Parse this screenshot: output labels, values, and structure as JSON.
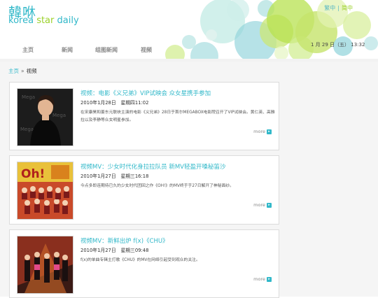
{
  "header": {
    "logo_cn": "韓咻",
    "logo_en_parts": [
      "korea ",
      "star",
      " daily"
    ],
    "lang": [
      "繁中",
      "|",
      "简中"
    ],
    "date": "1  月  29  日（五）  13:32"
  },
  "nav": [
    "主页",
    "新闻",
    "组图新闻",
    "视频"
  ],
  "breadcrumb": {
    "home": "主页",
    "sep": "»",
    "current": "视频"
  },
  "articles": [
    {
      "title": "视频：电影《义兄弟》VIP试映会 众女星携手参加",
      "date": "2010年1月28日　星期四11:02",
      "desc": "在宋康昊和姜东元联袂主演的电影《义兄弟》28日于首尔MEGABOX电影院召开了VIP试映会。黄仁英、高雅拉以及李静等众女明星参加。",
      "more": "more"
    },
    {
      "title": "视频MV：少女时代化身拉拉队员 新MV轻盈开嗓秘笛沙",
      "date": "2010年1月27日　星期三16:18",
      "desc": "今点多即连期待已久的少女时代团回之作《OH!》的MV终于于27日解开了神秘面纱。",
      "more": "more"
    },
    {
      "title": "视频MV：新鲜出炉 f(x)《CHU》",
      "date": "2010年1月27日　星期三09:48",
      "desc": "f(x)的单曲专辑主打歌《CHU》的MV在网络引起受到观众的关注。",
      "more": "more"
    }
  ],
  "colors": {
    "accent": "#31b8c9",
    "lime": "#9bd12a"
  }
}
